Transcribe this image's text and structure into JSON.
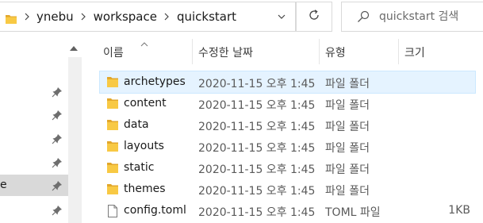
{
  "address_bar": {
    "breadcrumbs": [
      "ynebu",
      "workspace",
      "quickstart"
    ],
    "folder_icon": "folder-icon",
    "dropdown_icon": "chevron-down-icon"
  },
  "refresh": {
    "icon": "refresh-icon"
  },
  "search": {
    "placeholder": "quickstart 검색",
    "icon": "search-icon"
  },
  "nav": {
    "items": [
      {
        "label": "",
        "pinned": true,
        "selected": false
      },
      {
        "label": "",
        "pinned": true,
        "selected": false
      },
      {
        "label": "",
        "pinned": true,
        "selected": false
      },
      {
        "label": "",
        "pinned": true,
        "selected": false
      },
      {
        "label": "e",
        "pinned": true,
        "selected": true
      },
      {
        "label": "",
        "pinned": true,
        "selected": false
      }
    ]
  },
  "columns": {
    "name": "이름",
    "date": "수정한 날짜",
    "type": "유형",
    "size": "크기"
  },
  "files": [
    {
      "name": "archetypes",
      "date": "2020-11-15 오후 1:45",
      "type": "파일 폴더",
      "size": "",
      "kind": "folder",
      "selected": true
    },
    {
      "name": "content",
      "date": "2020-11-15 오후 1:45",
      "type": "파일 폴더",
      "size": "",
      "kind": "folder",
      "selected": false
    },
    {
      "name": "data",
      "date": "2020-11-15 오후 1:45",
      "type": "파일 폴더",
      "size": "",
      "kind": "folder",
      "selected": false
    },
    {
      "name": "layouts",
      "date": "2020-11-15 오후 1:45",
      "type": "파일 폴더",
      "size": "",
      "kind": "folder",
      "selected": false
    },
    {
      "name": "static",
      "date": "2020-11-15 오후 1:45",
      "type": "파일 폴더",
      "size": "",
      "kind": "folder",
      "selected": false
    },
    {
      "name": "themes",
      "date": "2020-11-15 오후 1:45",
      "type": "파일 폴더",
      "size": "",
      "kind": "folder",
      "selected": false
    },
    {
      "name": "config.toml",
      "date": "2020-11-15 오후 1:45",
      "type": "TOML 파일",
      "size": "1KB",
      "kind": "file",
      "selected": false
    }
  ],
  "colors": {
    "folder": "#f8c944",
    "folder_dark": "#e2a72b",
    "selection": "#e5f3ff",
    "nav_selected": "#d9d9d9"
  }
}
